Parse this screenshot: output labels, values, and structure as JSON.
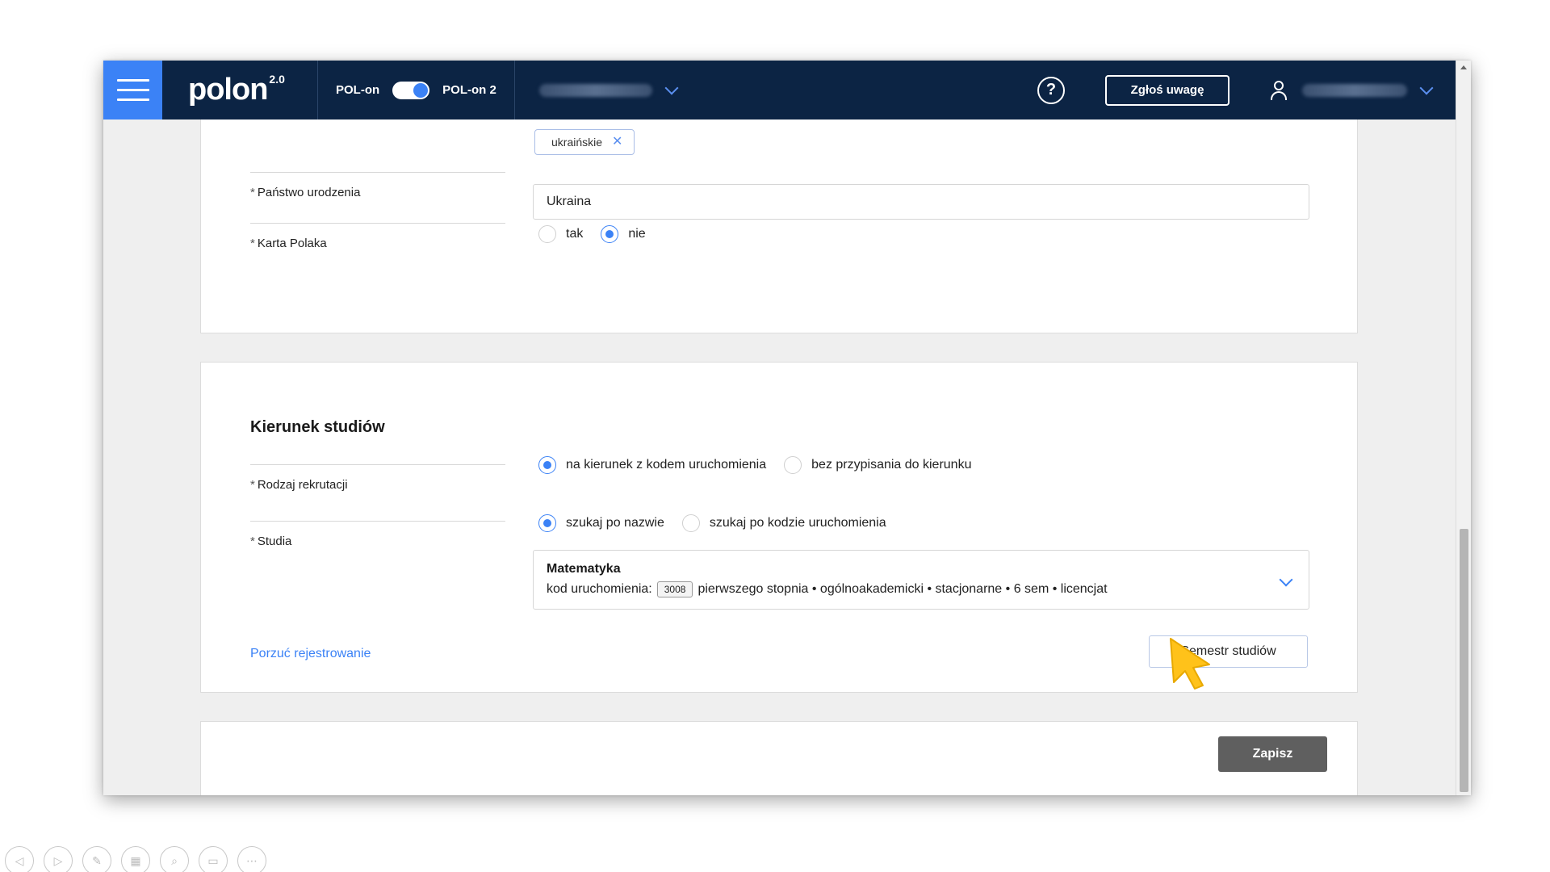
{
  "topbar": {
    "logo": "polon",
    "logo_version": "2.0",
    "switch_left": "POL-on",
    "switch_right": "POL-on 2",
    "help_symbol": "?",
    "report_button": "Zgłoś uwagę"
  },
  "personal": {
    "nationality_chip": "ukraińskie",
    "birth_country_label": "Państwo urodzenia",
    "birth_country_value": "Ukraina",
    "karta_label": "Karta Polaka",
    "karta_options": [
      "tak",
      "nie"
    ],
    "karta_selected": "nie"
  },
  "study": {
    "section_title": "Kierunek studiów",
    "recruitment_label": "Rodzaj rekrutacji",
    "recruitment_options": [
      "na kierunek z kodem uruchomienia",
      "bez przypisania do kierunku"
    ],
    "recruitment_selected": "na kierunek z kodem uruchomienia",
    "studies_label": "Studia",
    "search_options": [
      "szukaj po nazwie",
      "szukaj po kodzie uruchomienia"
    ],
    "search_selected": "szukaj po nazwie",
    "selected_program": {
      "name": "Matematyka",
      "code_label": "kod uruchomienia:",
      "code": "3008",
      "details": "pierwszego stopnia • ogólnoakademicki • stacjonarne • 6 sem • licencjat"
    },
    "abandon_link": "Porzuć rejestrowanie",
    "semester_button": "Semestr studiów"
  },
  "footer": {
    "save_button": "Zapisz"
  },
  "colors": {
    "topbar": "#0c2444",
    "accent": "#3b82f6",
    "save": "#5f5f5f"
  }
}
